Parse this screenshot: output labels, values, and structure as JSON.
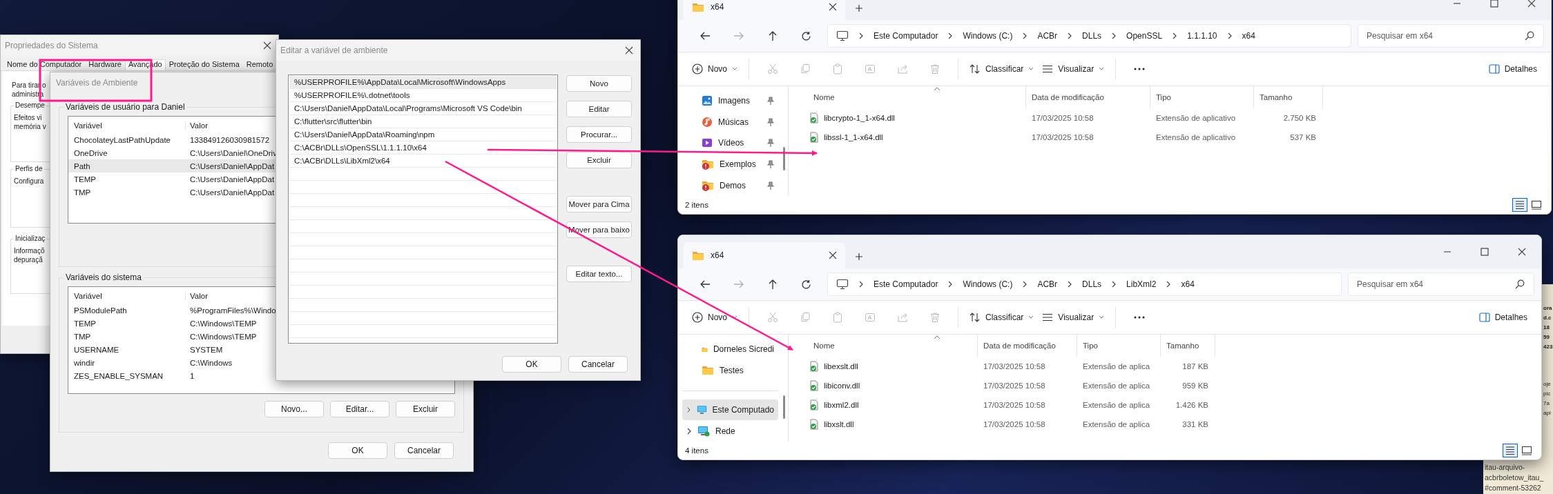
{
  "system_properties": {
    "title": "Propriedades do Sistema",
    "tabs": [
      {
        "label": "Nome do Computador",
        "selected": false
      },
      {
        "label": "Hardware",
        "selected": false
      },
      {
        "label": "Avançado",
        "selected": true
      },
      {
        "label": "Proteção do Sistema",
        "selected": false
      },
      {
        "label": "Remoto",
        "selected": false
      }
    ],
    "intro": [
      "Para tirar o",
      "administra"
    ],
    "groups": [
      {
        "title": "Desempe",
        "lines": [
          "Efeitos vi",
          "memória v"
        ]
      },
      {
        "title": "Perfis de",
        "lines": [
          "Configura"
        ]
      },
      {
        "title": "Inicializaç",
        "lines": [
          "Informaçõ",
          "depuraçã"
        ]
      }
    ]
  },
  "environment_variables": {
    "title": "Variáveis de Ambiente",
    "user_section": {
      "title": "Variáveis de usuário para Daniel",
      "columns": [
        "Variável",
        "Valor"
      ],
      "rows": [
        {
          "variable": "ChocolateyLastPathUpdate",
          "value": "133849126030981572",
          "selected": false
        },
        {
          "variable": "OneDrive",
          "value": "C:\\Users\\Daniel\\OneDriv",
          "selected": false
        },
        {
          "variable": "Path",
          "value": "C:\\Users\\Daniel\\AppDat",
          "selected": true
        },
        {
          "variable": "TEMP",
          "value": "C:\\Users\\Daniel\\AppDat",
          "selected": false
        },
        {
          "variable": "TMP",
          "value": "C:\\Users\\Daniel\\AppDat",
          "selected": false
        }
      ]
    },
    "system_section": {
      "title": "Variáveis do sistema",
      "columns": [
        "Variável",
        "Valor"
      ],
      "rows": [
        {
          "variable": "PSModulePath",
          "value": "%ProgramFiles%\\Windo",
          "selected": false
        },
        {
          "variable": "TEMP",
          "value": "C:\\Windows\\TEMP",
          "selected": false
        },
        {
          "variable": "TMP",
          "value": "C:\\Windows\\TEMP",
          "selected": false
        },
        {
          "variable": "USERNAME",
          "value": "SYSTEM",
          "selected": false
        },
        {
          "variable": "windir",
          "value": "C:\\Windows",
          "selected": false
        },
        {
          "variable": "ZES_ENABLE_SYSMAN",
          "value": "1",
          "selected": false
        }
      ],
      "buttons": [
        "Novo...",
        "Editar...",
        "Excluir"
      ]
    },
    "buttons": [
      "OK",
      "Cancelar"
    ]
  },
  "edit_variable": {
    "title": "Editar a variável de ambiente",
    "entries": [
      {
        "text": "%USERPROFILE%\\AppData\\Local\\Microsoft\\WindowsApps",
        "selected": true
      },
      {
        "text": "%USERPROFILE%\\.dotnet\\tools",
        "selected": false
      },
      {
        "text": "C:\\Users\\Daniel\\AppData\\Local\\Programs\\Microsoft VS Code\\bin",
        "selected": false
      },
      {
        "text": "C:\\flutter\\src\\flutter\\bin",
        "selected": false
      },
      {
        "text": "C:\\Users\\Daniel\\AppData\\Roaming\\npm",
        "selected": false
      },
      {
        "text": "C:\\ACBr\\DLLs\\OpenSSL\\1.1.1.10\\x64",
        "selected": false
      },
      {
        "text": "C:\\ACBr\\DLLs\\LibXml2\\x64",
        "selected": false
      }
    ],
    "button_groups": [
      [
        "Novo",
        "Editar",
        "Procurar...",
        "Excluir"
      ],
      [
        "Mover para Cima",
        "Mover para baixo"
      ],
      [
        "Editar texto..."
      ]
    ],
    "buttons": [
      "OK",
      "Cancelar"
    ]
  },
  "explorers": [
    {
      "tab_title": "x64",
      "breadcrumb": [
        "Este Computador",
        "Windows (C:)",
        "ACBr",
        "DLLs",
        "OpenSSL",
        "1.1.1.10",
        "x64"
      ],
      "search_placeholder": "Pesquisar em x64",
      "toolbar": {
        "new": "Novo",
        "sort": "Classificar",
        "view": "Visualizar",
        "details": "Detalhes",
        "actions": [
          {
            "kind": "cut",
            "disabled": true
          },
          {
            "kind": "copy",
            "disabled": true
          },
          {
            "kind": "paste",
            "disabled": true
          },
          {
            "kind": "rename",
            "disabled": true
          },
          {
            "kind": "share",
            "disabled": true
          },
          {
            "kind": "delete",
            "disabled": true
          }
        ]
      },
      "sidebar": [
        {
          "label": "Imagens",
          "kind": "images",
          "pinned": true,
          "expander": false,
          "selected": false
        },
        {
          "label": "Músicas",
          "kind": "music",
          "pinned": true,
          "expander": false,
          "selected": false
        },
        {
          "label": "Vídeos",
          "kind": "videos",
          "pinned": true,
          "expander": false,
          "selected": false
        },
        {
          "label": "Exemplos",
          "kind": "folder-alert",
          "pinned": true,
          "expander": false,
          "selected": false
        },
        {
          "label": "Demos",
          "kind": "folder-alert",
          "pinned": true,
          "expander": false,
          "selected": false
        }
      ],
      "columns": [
        "Nome",
        "Data de modificação",
        "Tipo",
        "Tamanho"
      ],
      "files": [
        {
          "name": "libcrypto-1_1-x64.dll",
          "modified": "17/03/2025 10:58",
          "type": "Extensão de aplicativo",
          "size": "2.750 KB"
        },
        {
          "name": "libssl-1_1-x64.dll",
          "modified": "17/03/2025 10:58",
          "type": "Extensão de aplicativo",
          "size": "537 KB"
        }
      ],
      "status": "2 itens",
      "view_buttons": [
        {
          "kind": "details",
          "selected": true
        },
        {
          "kind": "tiles",
          "selected": false
        }
      ]
    },
    {
      "tab_title": "x64",
      "breadcrumb": [
        "Este Computador",
        "Windows (C:)",
        "ACBr",
        "DLLs",
        "LibXml2",
        "x64"
      ],
      "search_placeholder": "Pesquisar em x64",
      "toolbar": {
        "new": "Novo",
        "sort": "Classificar",
        "view": "Visualizar",
        "details": "Detalhes",
        "actions": [
          {
            "kind": "cut",
            "disabled": true
          },
          {
            "kind": "copy",
            "disabled": true
          },
          {
            "kind": "paste",
            "disabled": true
          },
          {
            "kind": "rename",
            "disabled": true
          },
          {
            "kind": "share",
            "disabled": true
          },
          {
            "kind": "delete",
            "disabled": true
          }
        ]
      },
      "sidebar": [
        {
          "label": "Dorneles Sicredi",
          "kind": "folder",
          "pinned": false,
          "expander": false,
          "selected": false
        },
        {
          "label": "Testes",
          "kind": "folder",
          "pinned": false,
          "expander": false,
          "selected": false
        },
        {
          "label": "Este Computado",
          "kind": "computer",
          "pinned": false,
          "expander": true,
          "selected": true
        },
        {
          "label": "Rede",
          "kind": "network",
          "pinned": false,
          "expander": true,
          "selected": false
        }
      ],
      "columns": [
        "Nome",
        "Data de modificação",
        "Tipo",
        "Tamanho"
      ],
      "files": [
        {
          "name": "libexslt.dll",
          "modified": "17/03/2025 10:58",
          "type": "Extensão de aplica",
          "size": "187 KB"
        },
        {
          "name": "libiconv.dll",
          "modified": "17/03/2025 10:58",
          "type": "Extensão de aplica",
          "size": "959 KB"
        },
        {
          "name": "libxml2.dll",
          "modified": "17/03/2025 10:58",
          "type": "Extensão de aplica",
          "size": "1.426 KB"
        },
        {
          "name": "libxslt.dll",
          "modified": "17/03/2025 10:58",
          "type": "Extensão de aplica",
          "size": "331 KB"
        }
      ],
      "status": "4 itens",
      "view_buttons": [
        {
          "kind": "details",
          "selected": true
        },
        {
          "kind": "tiles",
          "selected": false
        }
      ]
    }
  ],
  "page_fragment": {
    "bold_lines": [
      "ora",
      "d.c",
      "18",
      "59",
      "423"
    ],
    "lines": [
      "oje",
      "pic",
      "7a",
      "api"
    ],
    "bottom_lines": [
      "itau-arquivo-",
      "acbrboletow_itau_",
      "#comment-53262"
    ]
  }
}
